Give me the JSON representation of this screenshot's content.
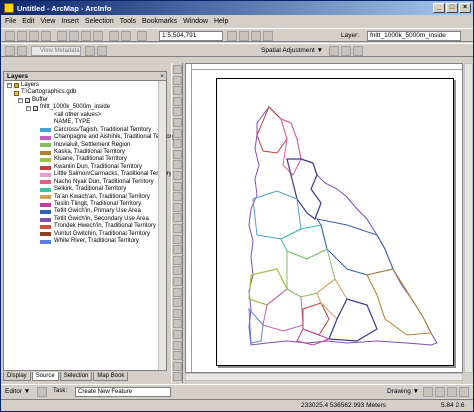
{
  "window": {
    "title": "Untitled - ArcMap - ArcInfo"
  },
  "menu": [
    "File",
    "Edit",
    "View",
    "Insert",
    "Selection",
    "Tools",
    "Bookmarks",
    "Window",
    "Help"
  ],
  "toolbar": {
    "scale": "1:5,504,791",
    "layer_label": "Layer:",
    "layer_value": "fnltt_1000k_5000m_inside",
    "metadata_label": "View Metadata",
    "spatial_adjustment": "Spatial Adjustment ▼"
  },
  "toc": {
    "title": "Layers",
    "database": "T:\\Cartographics.gdb",
    "group": "Buffer",
    "layer": "fnltt_1000k_5000m_inside",
    "legend": [
      {
        "label": "<all other values>",
        "color": ""
      },
      {
        "label": "NAME, TYPE",
        "color": ""
      },
      {
        "label": "Carcross/Tagish, Traditional Territory",
        "color": "#4aa0d0"
      },
      {
        "label": "Champagne and Aishihik, Traditional Territory",
        "color": "#c060c0"
      },
      {
        "label": "Inuvialuit, Settlement Region",
        "color": "#80c060"
      },
      {
        "label": "Kaska, Traditional Territory",
        "color": "#b08030"
      },
      {
        "label": "Kluane, Traditional Territory",
        "color": "#a0c040"
      },
      {
        "label": "Kwanlin Dun, Traditional Territory",
        "color": "#c04040"
      },
      {
        "label": "Little Salmon/Carmacks, Traditional Territory",
        "color": "#e0a0d0"
      },
      {
        "label": "Nacho Nyak Dun, Traditional Territory",
        "color": "#e06080"
      },
      {
        "label": "Selkirk, Traditional Territory",
        "color": "#40c0a0"
      },
      {
        "label": "Ta'an Kwach'an, Traditional Territory",
        "color": "#d0a060"
      },
      {
        "label": "Teslin Tlingit, Traditional Territory",
        "color": "#c040a0"
      },
      {
        "label": "Tetlit Gwich'in, Primary Use Area",
        "color": "#3060b0"
      },
      {
        "label": "Tetlit Gwich'in, Secondary Use Area",
        "color": "#8050b0"
      },
      {
        "label": "Trondek Hwech'in, Traditional Territory",
        "color": "#d05040"
      },
      {
        "label": "Vuntut Gwitchin, Traditional Territory",
        "color": "#904020"
      },
      {
        "label": "White River, Traditional Territory",
        "color": "#6080e0"
      }
    ]
  },
  "tabs": [
    "Display",
    "Source",
    "Selection",
    "Map Book"
  ],
  "active_tab": "Source",
  "drawing": {
    "drawing_label": "Drawing ▼"
  },
  "editor": {
    "label": "Editor ▼",
    "task": "Create New Feature"
  },
  "status": {
    "coords": "233025.4  536562.993 Meters",
    "page_coords": "5.84  2.6"
  }
}
